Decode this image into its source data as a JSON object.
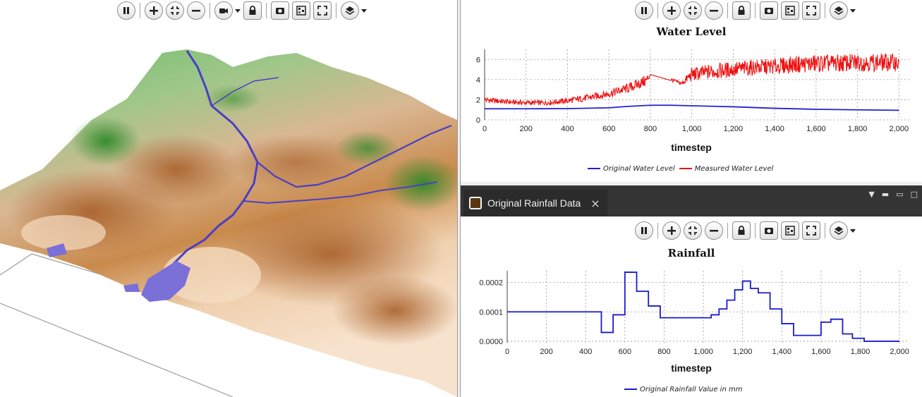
{
  "terrain_view": {
    "toolbar": [
      "pause-icon",
      "zoom-in-icon",
      "fit-icon",
      "zoom-out-icon",
      "camera-icon",
      "lock-icon",
      "snapshot-icon",
      "antialias-icon",
      "fullscreen-icon",
      "layers-icon"
    ]
  },
  "water_level_panel": {
    "toolbar": [
      "pause-icon",
      "zoom-in-icon",
      "fit-icon",
      "zoom-out-icon",
      "lock-icon",
      "snapshot-icon",
      "antialias-icon",
      "fullscreen-icon",
      "layers-icon"
    ],
    "colors": {
      "original": "#2222cc",
      "measured": "#ee1111"
    }
  },
  "rainfall_panel": {
    "tab_label": "Original Rainfall Data",
    "tab_close": "×",
    "window_controls": [
      "▼",
      "▬",
      "▭",
      "□"
    ],
    "toolbar": [
      "pause-icon",
      "zoom-in-icon",
      "fit-icon",
      "zoom-out-icon",
      "lock-icon",
      "snapshot-icon",
      "antialias-icon",
      "fullscreen-icon",
      "layers-icon"
    ],
    "colors": {
      "rainfall": "#1a1acc"
    }
  },
  "chart_data": [
    {
      "type": "line",
      "title": "Water Level",
      "xlabel": "timestep",
      "ylabel": "",
      "xlim": [
        0,
        2050
      ],
      "ylim": [
        0,
        7
      ],
      "x_ticks": [
        "0",
        "200",
        "400",
        "600",
        "800",
        "1,000",
        "1,200",
        "1,400",
        "1,600",
        "1,800",
        "2,000"
      ],
      "y_ticks": [
        "0",
        "2",
        "4",
        "6"
      ],
      "grid": true,
      "legend_position": "bottom",
      "series": [
        {
          "name": "Original Water Level",
          "x": [
            0,
            200,
            400,
            600,
            700,
            800,
            900,
            1000,
            1200,
            1400,
            1600,
            1800,
            2000
          ],
          "y": [
            1.1,
            1.1,
            1.12,
            1.2,
            1.35,
            1.45,
            1.45,
            1.4,
            1.3,
            1.15,
            1.05,
            1.0,
            0.95
          ]
        },
        {
          "name": "Measured Water Level",
          "x": [
            0,
            100,
            200,
            300,
            400,
            500,
            600,
            700,
            780,
            800,
            900,
            950,
            1000,
            1100,
            1200,
            1300,
            1400,
            1500,
            1600,
            1700,
            1800,
            1900,
            2000
          ],
          "y": [
            2.0,
            1.8,
            1.7,
            1.7,
            1.9,
            2.2,
            2.6,
            3.2,
            3.9,
            4.5,
            4.0,
            3.6,
            4.5,
            4.8,
            5.0,
            5.2,
            5.3,
            5.5,
            5.6,
            5.6,
            5.7,
            5.7,
            5.7
          ],
          "noise_amplitude": [
            0.6,
            0.5,
            0.5,
            0.5,
            0.6,
            0.7,
            0.8,
            1.0,
            1.2,
            0.4,
            0.4,
            0.4,
            1.4,
            1.6,
            1.6,
            1.6,
            1.6,
            1.7,
            1.8,
            1.8,
            1.8,
            1.8,
            1.8
          ]
        }
      ]
    },
    {
      "type": "line",
      "title": "Rainfall",
      "xlabel": "timestep",
      "ylabel": "",
      "xlim": [
        0,
        2050
      ],
      "ylim": [
        -5e-06,
        0.00024
      ],
      "x_ticks": [
        "0",
        "200",
        "400",
        "600",
        "800",
        "1,000",
        "1,200",
        "1,400",
        "1,600",
        "1,800",
        "2,000"
      ],
      "y_ticks": [
        "0.0000",
        "0.0001",
        "0.0002"
      ],
      "grid": true,
      "legend_position": "bottom",
      "step": true,
      "series": [
        {
          "name": "Original Rainfall Value in mm",
          "x": [
            0,
            480,
            540,
            600,
            660,
            720,
            780,
            1000,
            1040,
            1080,
            1120,
            1160,
            1200,
            1240,
            1280,
            1340,
            1400,
            1460,
            1600,
            1650,
            1710,
            1760,
            1820,
            1880,
            2000
          ],
          "y": [
            0.0001,
            3e-05,
            9e-05,
            0.000235,
            0.00017,
            0.00012,
            8e-05,
            8e-05,
            9e-05,
            0.00011,
            0.00014,
            0.000175,
            0.000205,
            0.00018,
            0.000165,
            0.00011,
            6e-05,
            2e-05,
            6.5e-05,
            7.5e-05,
            2.5e-05,
            1e-05,
            0.0,
            0.0,
            0.0
          ]
        }
      ]
    }
  ]
}
